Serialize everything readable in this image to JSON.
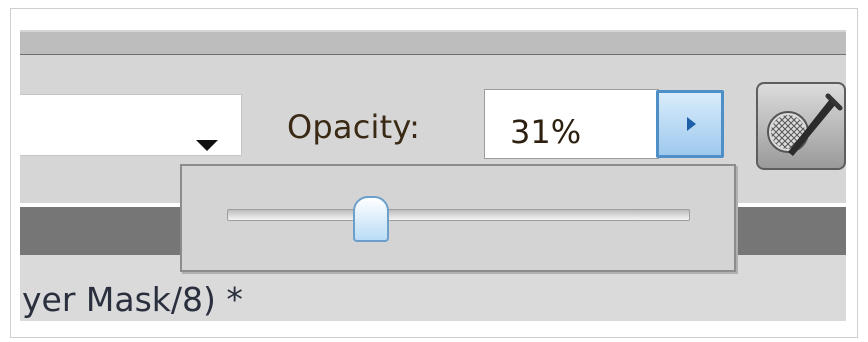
{
  "toolbar": {
    "opacity_label": "Opacity:",
    "opacity_value": "31%",
    "opacity_percent": 31
  },
  "document": {
    "title_fragment": "yer Mask/8) *"
  },
  "colors": {
    "toolbar_bg": "#d6d6d6",
    "accent_blue": "#4f8fc7"
  },
  "icons": {
    "dropdown": "triangle-down-icon",
    "opacity_toggle": "triangle-right-icon",
    "brush": "airbrush-icon"
  }
}
